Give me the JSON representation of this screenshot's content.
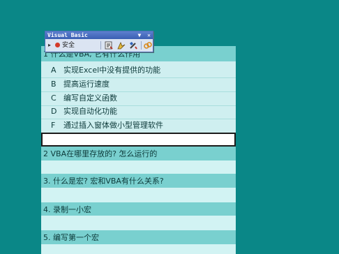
{
  "toolbar": {
    "title": "Visual Basic",
    "dropdown_glyph": "▼",
    "close_glyph": "✕",
    "arrow_glyph": "▸",
    "run_label": "安全",
    "icons": [
      "code-icon",
      "design-mode-icon",
      "tools-icon",
      "link-icon"
    ],
    "colors": {
      "title_bar": "#3a5fb2",
      "body": "#dbe4f2"
    }
  },
  "sheet": {
    "colors": {
      "background": "#0a8787",
      "header_row": "#79d0cf",
      "plain_row": "#d2f3f3"
    },
    "q1": "1 什么是VBA, 它有什么作用",
    "options": [
      {
        "key": "A",
        "text": "实现Excel中没有提供的功能"
      },
      {
        "key": "B",
        "text": "提高运行速度"
      },
      {
        "key": "C",
        "text": "编写自定义函数"
      },
      {
        "key": "D",
        "text": "实现自动化功能"
      },
      {
        "key": "F",
        "text": "通过插入窗体做小型管理软件"
      }
    ],
    "q2": "2 VBA在哪里存放的? 怎么运行的",
    "q3": "3. 什么是宏? 宏和VBA有什么关系?",
    "q4": "4. 录制一小宏",
    "q5": "5. 编写第一个宏"
  }
}
